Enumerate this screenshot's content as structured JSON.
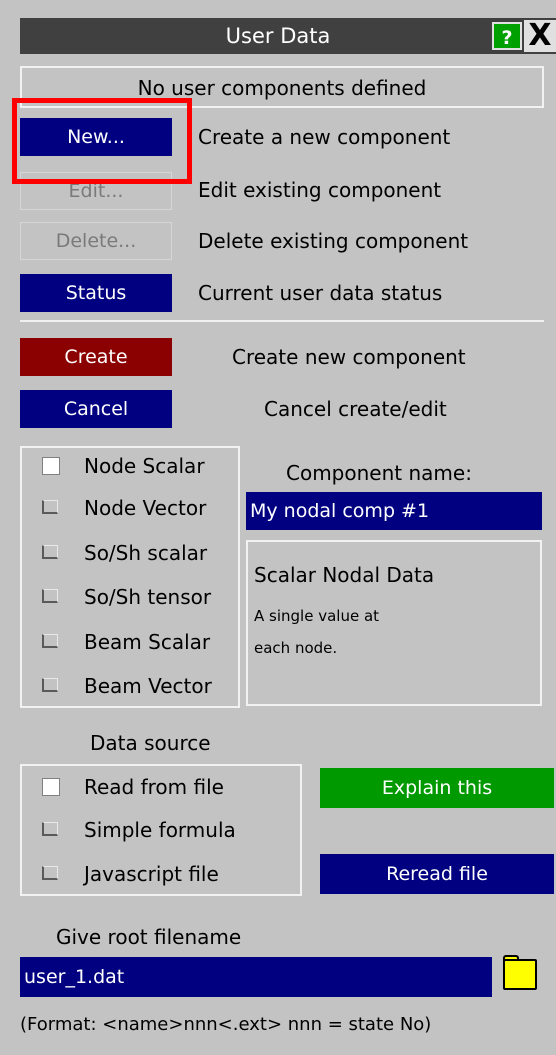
{
  "window": {
    "title": "User Data",
    "help_label": "?",
    "close_label": "X"
  },
  "info": {
    "text": "No user components defined"
  },
  "actions": [
    {
      "button": "New...",
      "description": "Create a new component",
      "enabled": true
    },
    {
      "button": "Edit...",
      "description": "Edit existing component",
      "enabled": false
    },
    {
      "button": "Delete...",
      "description": "Delete existing component",
      "enabled": false
    },
    {
      "button": "Status",
      "description": "Current user data status",
      "enabled": true
    }
  ],
  "create": {
    "button": "Create",
    "description": "Create new component"
  },
  "cancel": {
    "button": "Cancel",
    "description": "Cancel create/edit"
  },
  "component_types": [
    {
      "label": "Node Scalar",
      "selected": true
    },
    {
      "label": "Node Vector",
      "selected": false
    },
    {
      "label": "So/Sh scalar",
      "selected": false
    },
    {
      "label": "So/Sh tensor",
      "selected": false
    },
    {
      "label": "Beam Scalar",
      "selected": false
    },
    {
      "label": "Beam Vector",
      "selected": false
    }
  ],
  "component_name": {
    "label": "Component name:",
    "value": "My nodal comp #1"
  },
  "description": {
    "title": "Scalar Nodal Data",
    "line1": "A single value at",
    "line2": "each node."
  },
  "data_source": {
    "label": "Data source",
    "options": [
      {
        "label": "Read from file",
        "selected": true
      },
      {
        "label": "Simple formula",
        "selected": false
      },
      {
        "label": "Javascript file",
        "selected": false
      }
    ],
    "explain_button": "Explain this",
    "reread_button": "Reread file"
  },
  "filename": {
    "label": "Give root filename",
    "value": "user_1.dat",
    "format_hint": "(Format: <name>nnn<.ext>  nnn = state No)"
  },
  "colors": {
    "panel": "#c3c3c3",
    "button_blue": "#000080",
    "button_red": "#8b0000",
    "button_green": "#009900",
    "highlight": "#ff0000"
  }
}
